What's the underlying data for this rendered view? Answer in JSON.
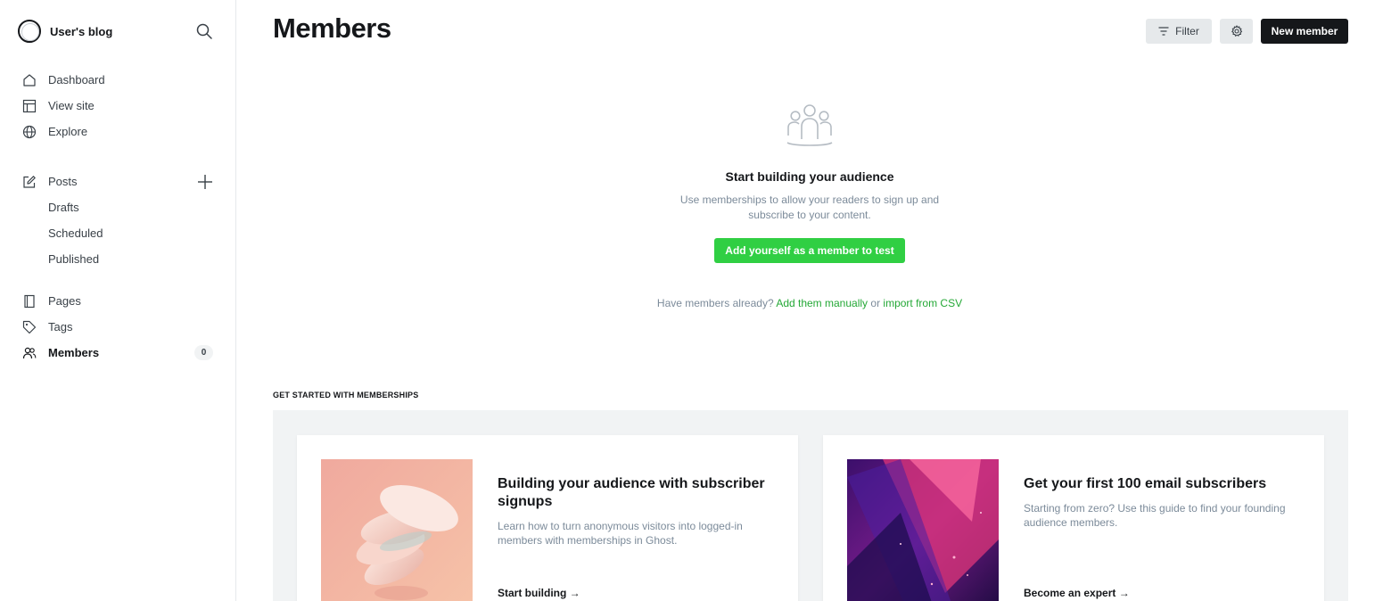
{
  "sidebar": {
    "brand_name": "User's blog",
    "search_icon": "search-icon",
    "primary": [
      {
        "label": "Dashboard",
        "icon": "home-icon"
      },
      {
        "label": "View site",
        "icon": "layout-icon"
      },
      {
        "label": "Explore",
        "icon": "globe-icon"
      }
    ],
    "posts": {
      "label": "Posts",
      "icon": "edit-icon"
    },
    "post_sub": [
      {
        "label": "Drafts"
      },
      {
        "label": "Scheduled"
      },
      {
        "label": "Published"
      }
    ],
    "secondary": [
      {
        "label": "Pages",
        "icon": "page-icon"
      },
      {
        "label": "Tags",
        "icon": "tag-icon"
      },
      {
        "label": "Members",
        "icon": "members-icon",
        "count": "0",
        "active": true
      }
    ]
  },
  "header": {
    "title": "Members",
    "filter_label": "Filter",
    "new_member_label": "New member"
  },
  "empty_state": {
    "title": "Start building your audience",
    "description": "Use memberships to allow your readers to sign up and subscribe to your content.",
    "cta_label": "Add yourself as a member to test",
    "have_members_text": "Have members already?",
    "add_manually_label": "Add them manually",
    "or_text": "or",
    "import_label": "import from CSV"
  },
  "getting_started": {
    "section_label": "GET STARTED WITH MEMBERSHIPS",
    "cards": [
      {
        "title": "Building your audience with subscriber signups",
        "description": "Learn how to turn anonymous visitors into logged-in members with memberships in Ghost.",
        "link_label": "Start building →"
      },
      {
        "title": "Get your first 100 email subscribers",
        "description": "Starting from zero? Use this guide to find your founding audience members.",
        "link_label": "Become an expert →"
      }
    ]
  },
  "colors": {
    "accent_green": "#30cf43",
    "link_green": "#24a836",
    "dark": "#15171a"
  }
}
